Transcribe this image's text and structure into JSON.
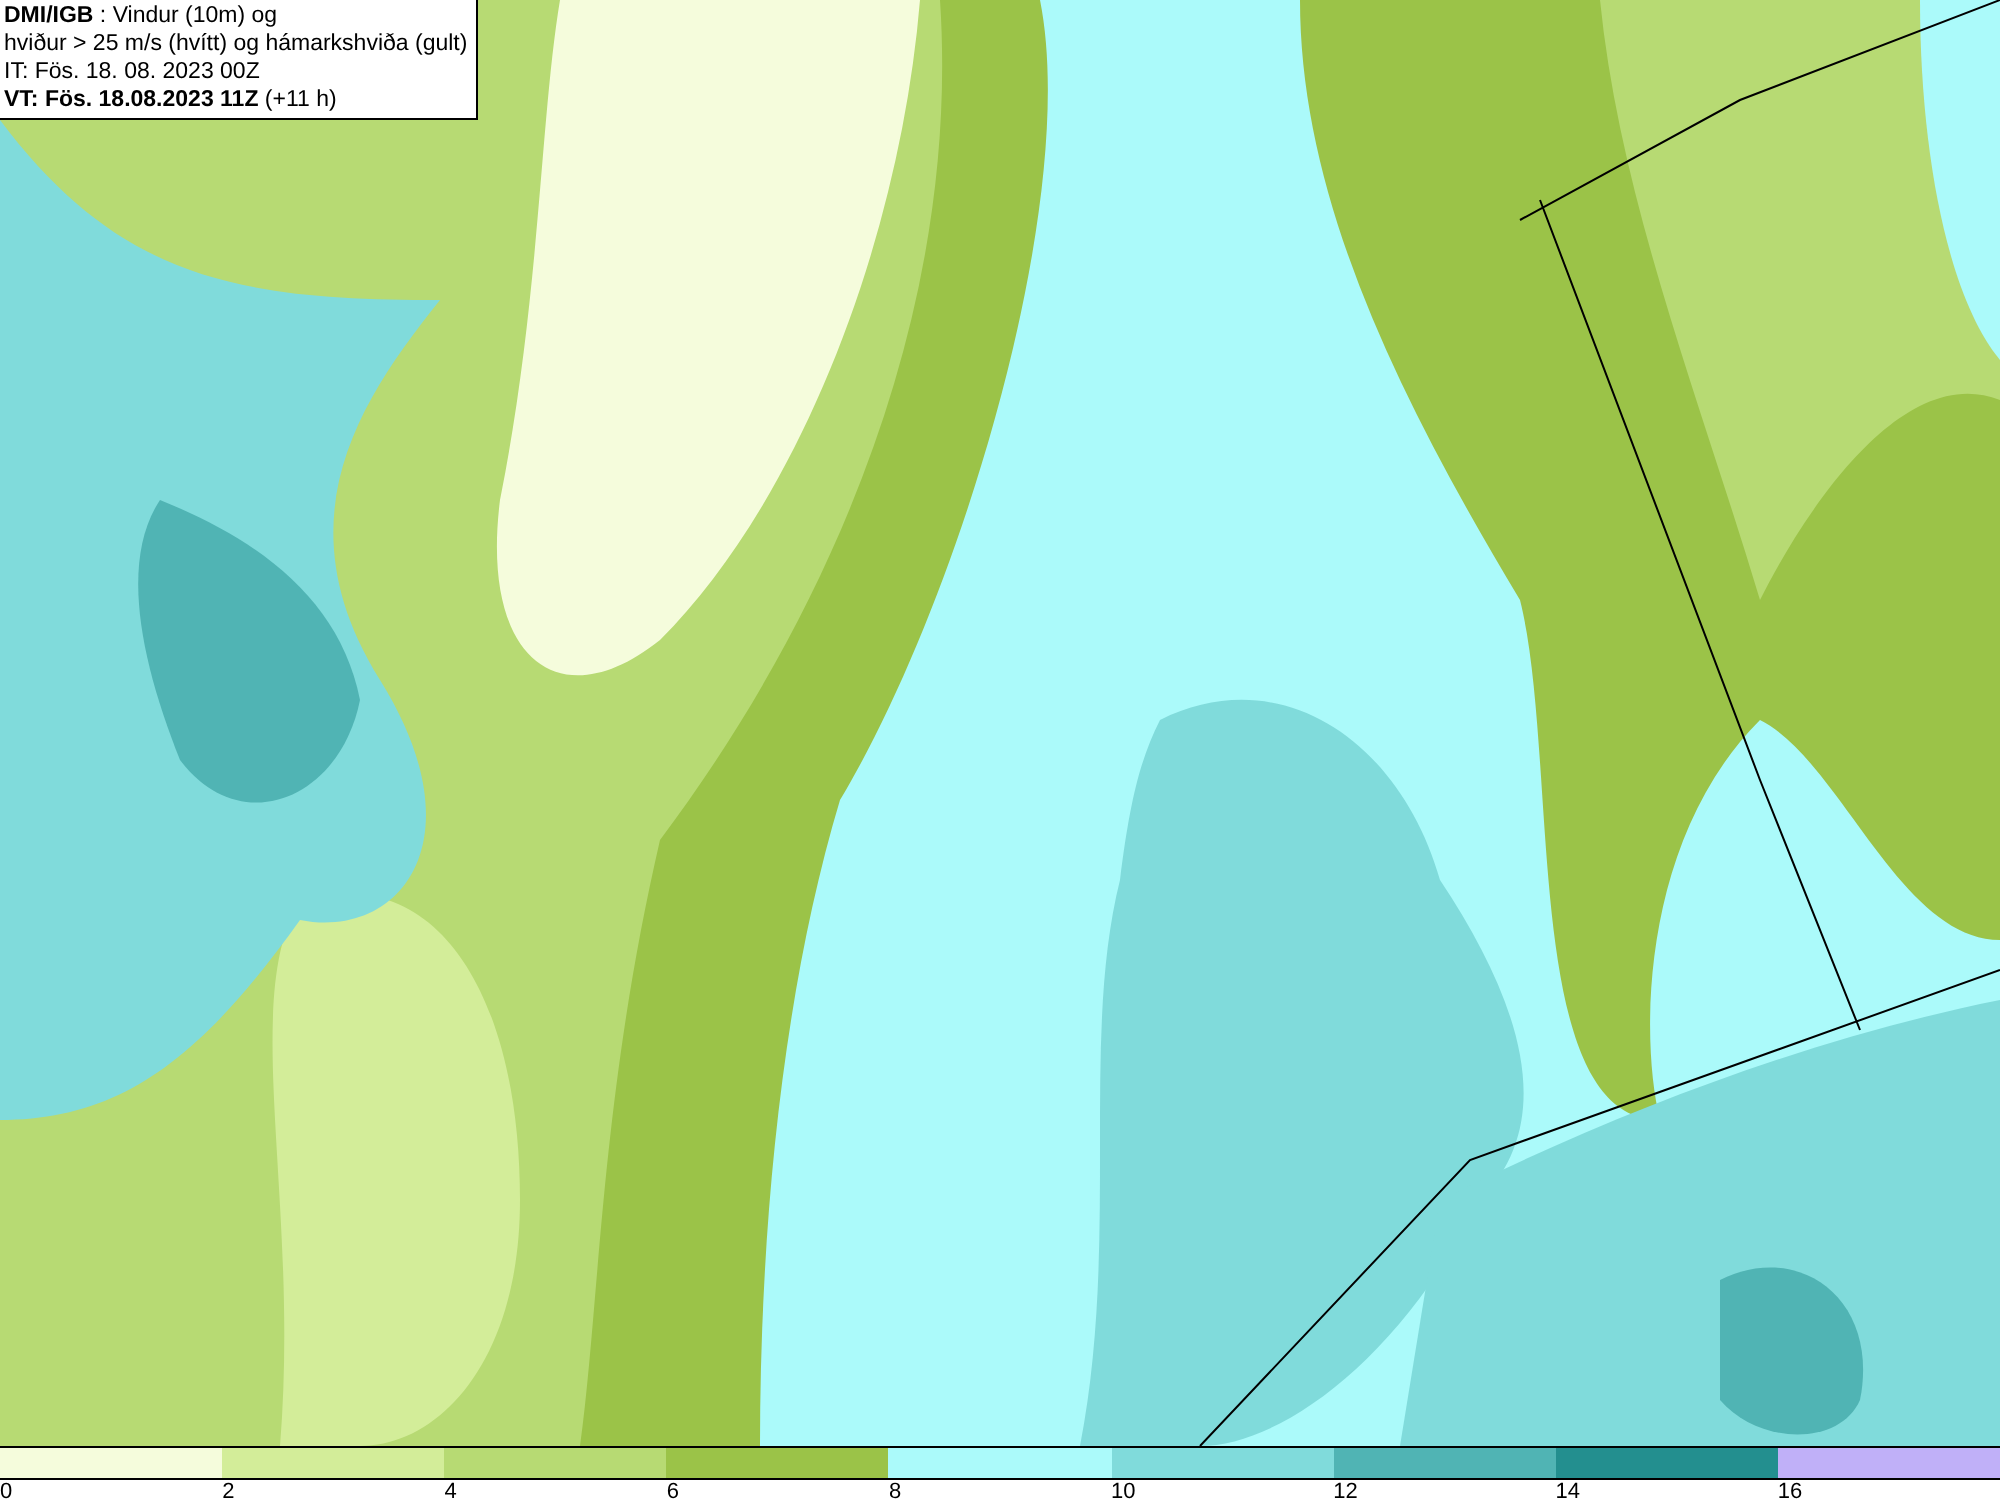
{
  "title_box": {
    "lines": [
      "**DMI/IGB** : Vindur (10m) og",
      "hviður > 25 m/s (hvítt) og hámarkshviða (gult)",
      "IT: Fös. 18. 08. 2023 00Z",
      "**VT: Fös. 18.08.2023 11Z** (+11 h)"
    ]
  },
  "legend": {
    "bins": [
      {
        "color": "#f5fcdc"
      },
      {
        "color": "#d3ed99"
      },
      {
        "color": "#b7da73"
      },
      {
        "color": "#9bc348"
      },
      {
        "color": "#abfafa"
      },
      {
        "color": "#80dbdb"
      },
      {
        "color": "#50b4b4"
      },
      {
        "color": "#238f8f"
      },
      {
        "color": "#c0b0f8"
      }
    ],
    "ticks": [
      "0",
      "2",
      "4",
      "6",
      "8",
      "10",
      "12",
      "14",
      "16"
    ]
  }
}
